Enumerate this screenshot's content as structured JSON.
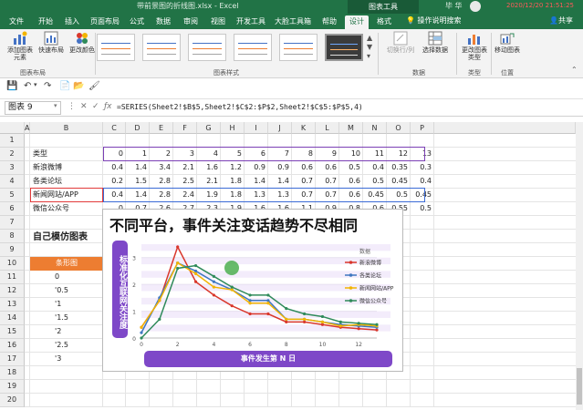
{
  "titlebar": {
    "doc_title": "带前景图的折线图.xlsx - Excel",
    "context_label": "图表工具",
    "user": "毕 华",
    "datetime": "2020/12/20 21:51:25"
  },
  "ribbon_tabs": [
    "文件",
    "开始",
    "插入",
    "页面布局",
    "公式",
    "数据",
    "审阅",
    "视图",
    "开发工具",
    "大脸工具箱",
    "帮助",
    "设计",
    "格式"
  ],
  "active_tab": "设计",
  "tell_me": "操作说明搜索",
  "share": "共享",
  "ribbon": {
    "add_element": "添加图表元素",
    "quick_layout": "快速布局",
    "change_colors": "更改颜色",
    "switch_row_col": "切换行/列",
    "select_data": "选择数据",
    "change_type": "更改图表类型",
    "move_chart": "移动图表",
    "group_layout": "图表布局",
    "group_styles": "图表样式",
    "group_data": "数据",
    "group_type": "类型",
    "group_location": "位置"
  },
  "namebox": "图表 9",
  "formula": "=SERIES(Sheet2!$B$5,Sheet2!$C$2:$P$2,Sheet2!$C$5:$P$5,4)",
  "columns": [
    "A",
    "B",
    "C",
    "D",
    "E",
    "F",
    "G",
    "H",
    "I",
    "J",
    "K",
    "L",
    "M",
    "N",
    "O",
    "P"
  ],
  "rows": [
    "1",
    "2",
    "3",
    "4",
    "5",
    "6",
    "7",
    "8",
    "9",
    "10",
    "11",
    "12",
    "13",
    "14",
    "15",
    "16",
    "17",
    "18",
    "19",
    "20"
  ],
  "table": {
    "labels": [
      "类型",
      "新浪微博",
      "各类论坛",
      "新闻网站/APP",
      "微信公众号"
    ],
    "data": [
      [
        "0",
        "1",
        "2",
        "3",
        "4",
        "5",
        "6",
        "7",
        "8",
        "9",
        "10",
        "11",
        "12",
        "13"
      ],
      [
        "0.4",
        "1.4",
        "3.4",
        "2.1",
        "1.6",
        "1.2",
        "0.9",
        "0.9",
        "0.6",
        "0.6",
        "0.5",
        "0.4",
        "0.35",
        "0.3"
      ],
      [
        "0.2",
        "1.5",
        "2.8",
        "2.5",
        "2.1",
        "1.8",
        "1.4",
        "1.4",
        "0.7",
        "0.7",
        "0.6",
        "0.5",
        "0.45",
        "0.4"
      ],
      [
        "0.4",
        "1.4",
        "2.8",
        "2.4",
        "1.9",
        "1.8",
        "1.3",
        "1.3",
        "0.7",
        "0.7",
        "0.6",
        "0.45",
        "0.5",
        "0.45"
      ],
      [
        "0",
        "0.7",
        "2.6",
        "2.7",
        "2.3",
        "1.9",
        "1.6",
        "1.6",
        "1.1",
        "0.9",
        "0.8",
        "0.6",
        "0.55",
        "0.5"
      ]
    ]
  },
  "side": {
    "heading": "自己模仿图表",
    "list_header": "条形图",
    "list": [
      "0",
      "'0.5",
      "'1",
      "'1.5",
      "'2",
      "'2.5",
      "'3"
    ]
  },
  "chart_data": {
    "type": "line",
    "title": "不同平台，事件关注变话趋势不尽相同",
    "ylabel": "标准化互联网关注度",
    "xlabel": "事件发生第 N 日",
    "x": [
      0,
      1,
      2,
      3,
      4,
      5,
      6,
      7,
      8,
      9,
      10,
      11,
      12,
      13
    ],
    "xticks": [
      "0",
      "2",
      "4",
      "6",
      "8",
      "10",
      "12"
    ],
    "yticks": [
      "0",
      "1",
      "2",
      "3"
    ],
    "xlim": [
      0,
      13
    ],
    "ylim": [
      0,
      3.5
    ],
    "legend_position": "right",
    "legend_header": "数据",
    "series": [
      {
        "name": "新浪微博",
        "color": "#d9372b",
        "values": [
          0.4,
          1.4,
          3.4,
          2.1,
          1.6,
          1.2,
          0.9,
          0.9,
          0.6,
          0.6,
          0.5,
          0.4,
          0.35,
          0.3
        ]
      },
      {
        "name": "各类论坛",
        "color": "#3f77c0",
        "values": [
          0.2,
          1.5,
          2.8,
          2.5,
          2.1,
          1.8,
          1.4,
          1.4,
          0.7,
          0.7,
          0.6,
          0.5,
          0.45,
          0.4
        ]
      },
      {
        "name": "新闻网站/APP",
        "color": "#f2b400",
        "values": [
          0.4,
          1.4,
          2.8,
          2.4,
          1.9,
          1.8,
          1.3,
          1.3,
          0.7,
          0.7,
          0.6,
          0.45,
          0.5,
          0.45
        ]
      },
      {
        "name": "微信公众号",
        "color": "#2f8a5a",
        "values": [
          0,
          0.7,
          2.6,
          2.7,
          2.3,
          1.9,
          1.6,
          1.6,
          1.1,
          0.9,
          0.8,
          0.6,
          0.55,
          0.5
        ]
      }
    ]
  }
}
